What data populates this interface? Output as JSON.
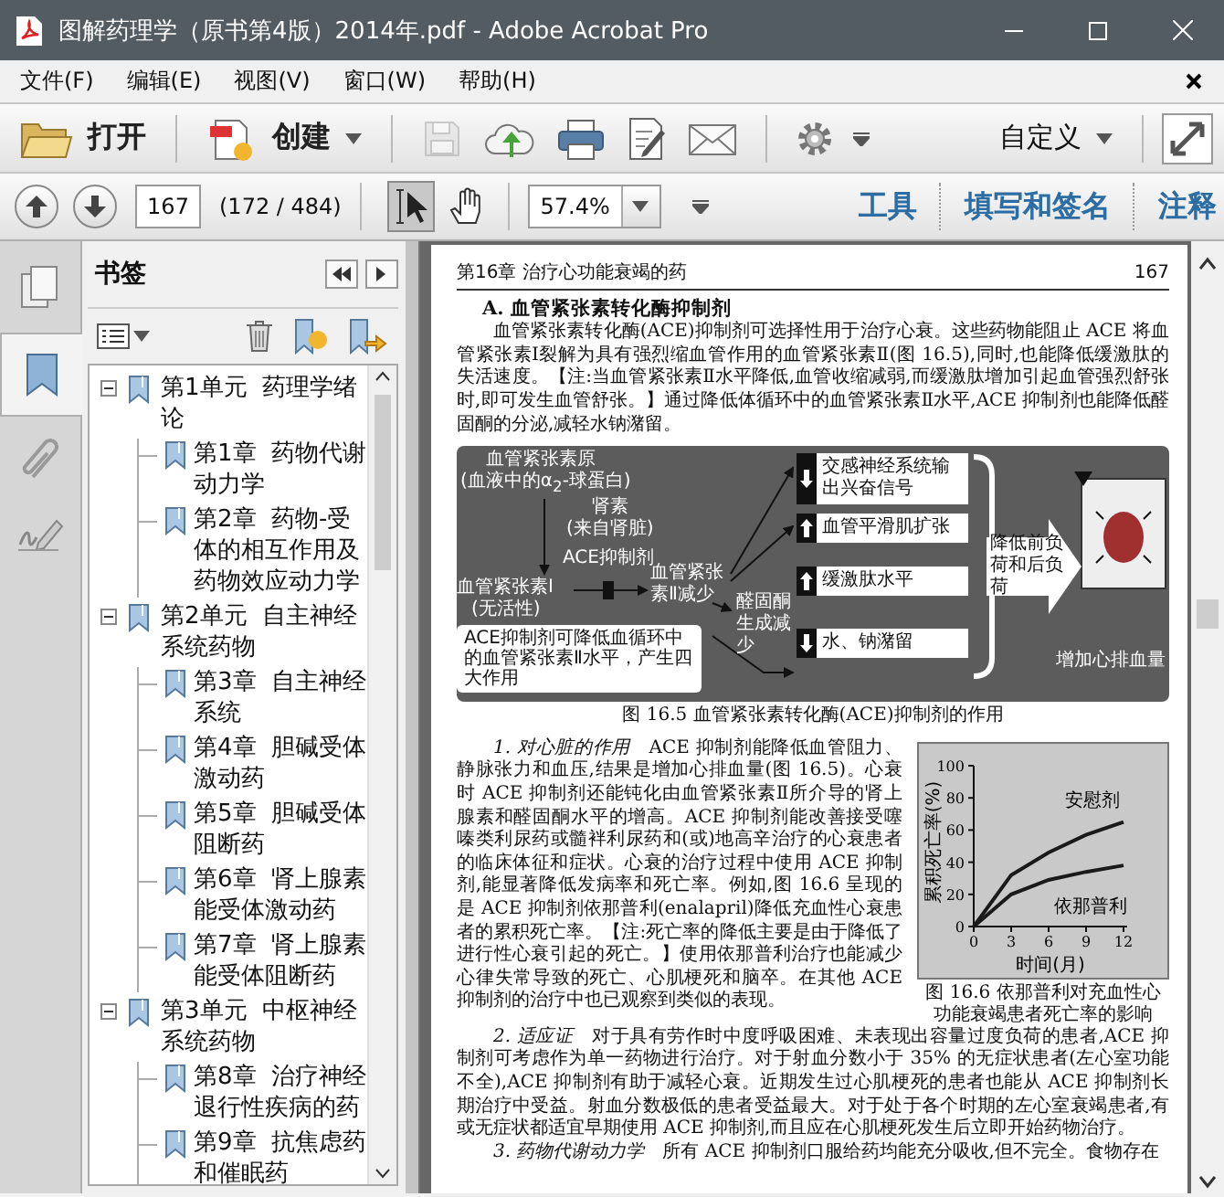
{
  "window": {
    "title": "图解药理学（原书第4版）2014年.pdf - Adobe Acrobat Pro"
  },
  "menu": [
    "文件(F)",
    "编辑(E)",
    "视图(V)",
    "窗口(W)",
    "帮助(H)"
  ],
  "toolbar": {
    "open": "打开",
    "create": "创建",
    "customize": "自定义",
    "tools": [
      {
        "kind": "save",
        "disabled": true
      },
      {
        "kind": "upload",
        "disabled": false
      },
      {
        "kind": "print",
        "disabled": false
      },
      {
        "kind": "edit",
        "disabled": false
      },
      {
        "kind": "mail",
        "disabled": false
      }
    ]
  },
  "nav": {
    "page": "167",
    "page_count": "(172 / 484)",
    "zoom": "57.4%",
    "tools": [
      {
        "kind": "select",
        "selected": true
      },
      {
        "kind": "hand",
        "selected": false
      }
    ],
    "links": [
      "工具",
      "填写和签名",
      "注释"
    ]
  },
  "side_tabs": [
    {
      "kind": "pages",
      "selected": false
    },
    {
      "kind": "bookmarks",
      "selected": true
    },
    {
      "kind": "attachments",
      "selected": false
    },
    {
      "kind": "signatures",
      "selected": false
    }
  ],
  "bookmarks": {
    "title": "书签",
    "items": [
      {
        "label": "第1单元  药理学绪论",
        "expanded": true,
        "children": [
          {
            "label": "第1章  药物代谢动力学"
          },
          {
            "label": "第2章  药物-受体的相互作用及药物效应动力学"
          }
        ]
      },
      {
        "label": "第2单元  自主神经系统药物",
        "expanded": true,
        "children": [
          {
            "label": "第3章  自主神经系统"
          },
          {
            "label": "第4章  胆碱受体激动药"
          },
          {
            "label": "第5章  胆碱受体阻断药"
          },
          {
            "label": "第6章  肾上腺素能受体激动药"
          },
          {
            "label": "第7章  肾上腺素能受体阻断药"
          }
        ]
      },
      {
        "label": "第3单元  中枢神经系统药物",
        "expanded": true,
        "children": [
          {
            "label": "第8章  治疗神经退行性疾病的药"
          },
          {
            "label": "第9章  抗焦虑药和催眠药"
          }
        ]
      }
    ]
  },
  "document": {
    "running_head": "第16章  治疗心功能衰竭的药",
    "page_number": "167",
    "heading": "A. 血管紧张素转化酶抑制剂",
    "intro": "血管紧张素转化酶(ACE)抑制剂可选择性用于治疗心衰。这些药物能阻止 ACE 将血管紧张素Ⅰ裂解为具有强烈缩血管作用的血管紧张素Ⅱ(图 16.5),同时,也能降低缓激肽的失活速度。【注:当血管紧张素Ⅱ水平降低,血管收缩减弱,而缓激肽增加引起血管强烈舒张时,即可发生血管舒张。】通过降低体循环中的血管紧张素Ⅱ水平,ACE 抑制剂也能降低醛固酮的分泌,减轻水钠潴留。",
    "diagram": {
      "source": "血管紧张素原",
      "source_note": "(血液中的α$_{2}$-球蛋白)",
      "renin": "肾素",
      "renin_note": "(来自肾脏)",
      "inhibitor": "ACE抑制剂",
      "ang1": "血管紧张素Ⅰ",
      "ang1_note": "(无活性)",
      "ang2": "血管紧张素Ⅱ减少",
      "aldosterone": "醛固酮生成减少",
      "callout": "ACE抑制剂可降低血循环中的血管紧张素Ⅱ水平，产生四大作用",
      "effects": [
        {
          "label": "交感神经系统输出兴奋信号",
          "kind": "decrease"
        },
        {
          "label": "血管平滑肌扩张",
          "kind": "increase"
        },
        {
          "label": "缓激肽水平",
          "kind": "increase"
        },
        {
          "label": "水、钠潴留",
          "kind": "decrease"
        }
      ],
      "result": "降低前负荷和后负荷",
      "outcome": "增加心排血量"
    },
    "figure_caption": "图 16.5  血管紧张素转化酶(ACE)抑制剂的作用",
    "chart_caption": "图 16.6  依那普利对充血性心功能衰竭患者死亡率的影响",
    "chart_data": {
      "type": "line",
      "xlabel": "时间(月)",
      "ylabel": "累积死亡率(%)",
      "x": [
        0,
        3,
        6,
        9,
        12
      ],
      "series": [
        {
          "name": "安慰剂",
          "color": "#1a1a1a",
          "values": [
            0,
            32,
            46,
            57,
            65
          ]
        },
        {
          "name": "依那普利",
          "color": "#1a1a1a",
          "values": [
            0,
            20,
            29,
            34,
            38
          ]
        }
      ],
      "xlim": [
        0,
        12
      ],
      "ylim": [
        0,
        100
      ],
      "xticks": [
        0,
        3,
        6,
        9,
        12
      ],
      "yticks": [
        0,
        20,
        40,
        60,
        80,
        100
      ]
    },
    "paragraphs": [
      "*1. 对心脏的作用*　ACE 抑制剂能降低血管阻力、静脉张力和血压,结果是增加心排血量(图 16.5)。心衰时 ACE 抑制剂还能钝化由血管紧张素Ⅱ所介导的肾上腺素和醛固酮水平的增高。ACE 抑制剂能改善接受噻嗪类利尿药或髓袢利尿药和(或)地高辛治疗的心衰患者的临床体征和症状。心衰的治疗过程中使用 ACE 抑制剂,能显著降低发病率和死亡率。例如,图 16.6 呈现的是 ACE 抑制剂依那普利(enalapril)降低充血性心衰患者的累积死亡率。【注:死亡率的降低主要是由于降低了进行性心衰引起的死亡。】使用依那普利治疗也能减少心律失常导致的死亡、心肌梗死和脑卒。在其他 ACE 抑制剂的治疗中也已观察到类似的表现。",
      "*2. 适应证*　对于具有劳作时中度呼吸困难、未表现出容量过度负荷的患者,ACE 抑制剂可考虑作为单一药物进行治疗。对于射血分数小于 35% 的无症状患者(左心室功能不全),ACE 抑制剂有助于减轻心衰。近期发生过心肌梗死的患者也能从 ACE 抑制剂长期治疗中受益。射血分数极低的患者受益最大。对于处于各个时期的左心室衰竭患者,有或无症状都适宜早期使用 ACE 抑制剂,而且应在心肌梗死发生后立即开始药物治疗。",
      "*3. 药物代谢动力学*　所有 ACE 抑制剂口服给药均能充分吸收,但不完全。食物存在"
    ]
  }
}
